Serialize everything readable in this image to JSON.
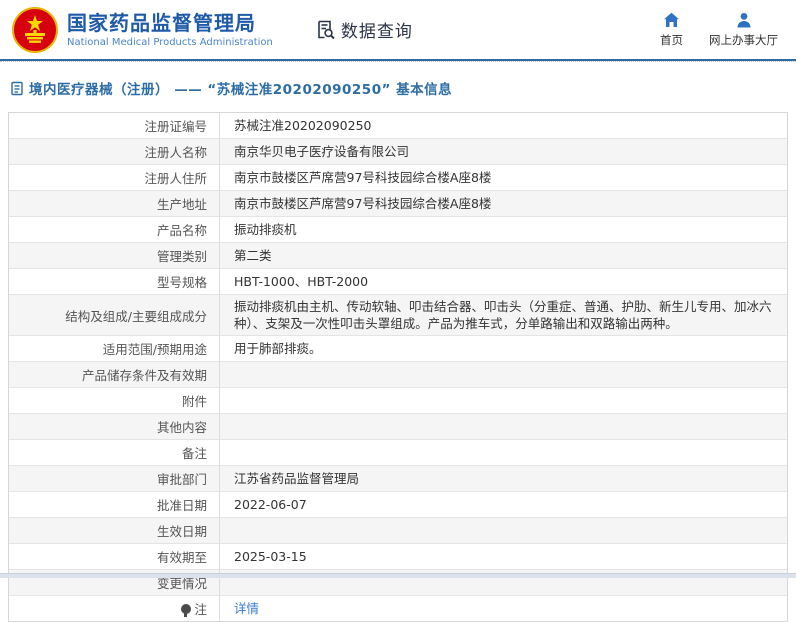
{
  "header": {
    "org_name_cn": "国家药品监督管理局",
    "org_name_en": "National Medical Products Administration",
    "section_title": "数据查询",
    "nav": [
      {
        "label": "首页",
        "icon": "home-icon"
      },
      {
        "label": "网上办事大厅",
        "icon": "user-icon"
      }
    ]
  },
  "breadcrumb": {
    "text": "境内医疗器械（注册） —— “苏械注准20202090250” 基本信息"
  },
  "table": {
    "rows": [
      {
        "label": "注册证编号",
        "value": "苏械注准20202090250"
      },
      {
        "label": "注册人名称",
        "value": "南京华贝电子医疗设备有限公司"
      },
      {
        "label": "注册人住所",
        "value": "南京市鼓楼区芦席营97号科技园综合楼A座8楼"
      },
      {
        "label": "生产地址",
        "value": "南京市鼓楼区芦席营97号科技园综合楼A座8楼"
      },
      {
        "label": "产品名称",
        "value": "振动排痰机"
      },
      {
        "label": "管理类别",
        "value": "第二类"
      },
      {
        "label": "型号规格",
        "value": "HBT-1000、HBT-2000"
      },
      {
        "label": "结构及组成/主要组成成分",
        "value": "振动排痰机由主机、传动软轴、叩击结合器、叩击头（分重症、普通、护肋、新生儿专用、加冰六种）、支架及一次性叩击头罩组成。产品为推车式，分单路输出和双路输出两种。"
      },
      {
        "label": "适用范围/预期用途",
        "value": "用于肺部排痰。"
      },
      {
        "label": "产品储存条件及有效期",
        "value": ""
      },
      {
        "label": "附件",
        "value": ""
      },
      {
        "label": "其他内容",
        "value": ""
      },
      {
        "label": "备注",
        "value": ""
      },
      {
        "label": "审批部门",
        "value": "江苏省药品监督管理局"
      },
      {
        "label": "批准日期",
        "value": "2022-06-07"
      },
      {
        "label": "生效日期",
        "value": ""
      },
      {
        "label": "有效期至",
        "value": "2025-03-15"
      },
      {
        "label": "变更情况",
        "value": ""
      },
      {
        "label": "注",
        "value": "详情",
        "link": true,
        "label_icon": "note-icon"
      }
    ]
  },
  "colors": {
    "brand_blue": "#1f5aa8",
    "breadcrumb_blue": "#2e6da4",
    "link_blue": "#3a7bd5",
    "nav_icon_blue": "#2f72c4",
    "emblem_red": "#d7000f",
    "emblem_gold": "#ffd700",
    "row_alt_bg": "#f5f5f5",
    "table_border": "#d6d6d6",
    "footer_strip": "#dce1ee"
  }
}
